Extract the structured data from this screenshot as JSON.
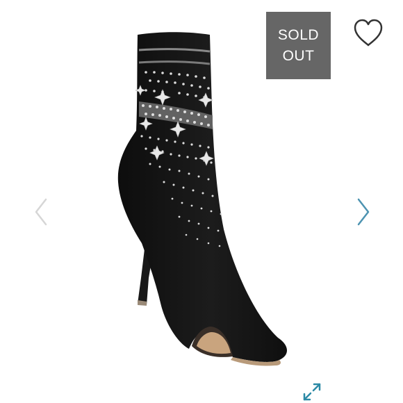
{
  "product": {
    "image_icon": "embellished-peep-toe-sock-bootie-image",
    "status_line1": "SOLD",
    "status_line2": "OUT"
  },
  "actions": {
    "like_icon": "heart-outline-icon",
    "prev_icon": "chevron-left-icon",
    "next_icon": "chevron-right-icon",
    "expand_icon": "expand-arrows-icon"
  },
  "colors": {
    "badge_background": "#666666",
    "badge_text": "#ffffff",
    "prev_arrow": "#d6d6d6",
    "next_arrow": "#4d93b1",
    "expand_icon": "#2c8aa6",
    "boot": "#141414"
  }
}
